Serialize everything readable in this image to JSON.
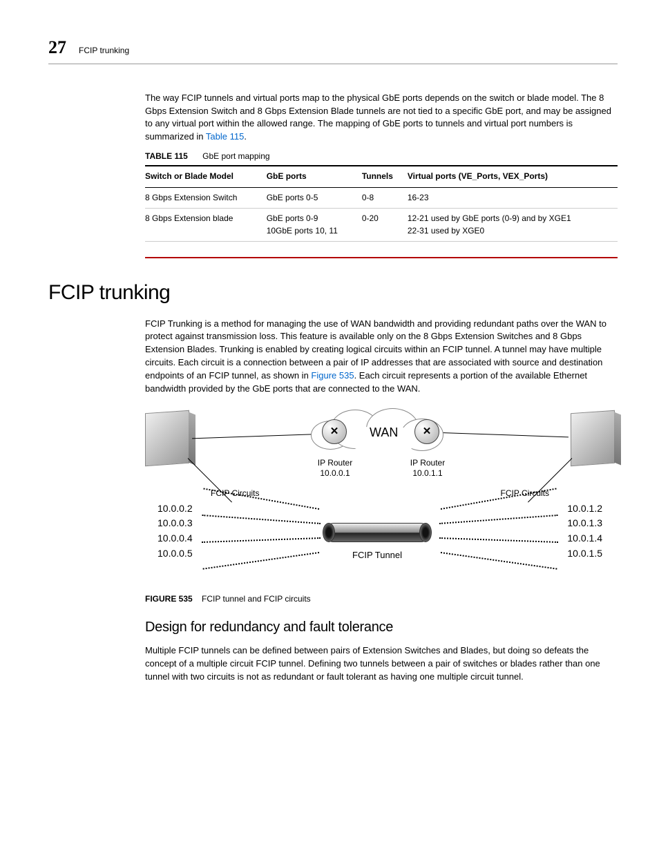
{
  "page_header": {
    "number": "27",
    "section": "FCIP trunking"
  },
  "intro_paragraph": "The way FCIP tunnels and virtual ports map to the physical GbE ports depends on the switch or blade model. The 8 Gbps Extension Switch and 8 Gbps Extension Blade tunnels are not tied to a specific GbE port, and may be assigned to any virtual port within the allowed range. The mapping of GbE ports to tunnels and virtual port numbers is summarized in ",
  "intro_link": "Table 115",
  "intro_tail": ".",
  "table": {
    "label": "TABLE 115",
    "title": "GbE port mapping",
    "headers": [
      "Switch or Blade Model",
      "GbE ports",
      "Tunnels",
      "Virtual ports (VE_Ports, VEX_Ports)"
    ],
    "rows": [
      {
        "model": "8 Gbps Extension Switch",
        "ports": "GbE ports 0-5",
        "tunnels": "0-8",
        "vports": "16-23"
      },
      {
        "model": "8 Gbps Extension blade",
        "ports": "GbE ports 0-9\n10GbE ports 10, 11",
        "tunnels": "0-20",
        "vports": "12-21 used by GbE ports (0-9) and by XGE1\n22-31 used by XGE0"
      }
    ]
  },
  "heading": "FCIP trunking",
  "body1a": "FCIP Trunking is a method for managing the use of WAN bandwidth and providing redundant paths over the WAN to protect against transmission loss. This feature is available only on the 8 Gbps Extension Switches and 8 Gbps Extension Blades. Trunking is enabled by creating logical circuits within an FCIP tunnel. A tunnel may have multiple circuits. Each circuit is a connection between a pair of IP addresses that are associated with source and destination endpoints of an FCIP tunnel, as shown in ",
  "body1_link": "Figure 535",
  "body1b": ". Each circuit represents a portion of the available Ethernet bandwidth provided by the GbE ports that are connected to the WAN.",
  "diagram": {
    "wan": "WAN",
    "router_glyph": "✕",
    "router_left_label": "IP Router\n10.0.0.1",
    "router_right_label": "IP Router\n10.0.1.1",
    "circuits_label": "FCIP Circuits",
    "tunnel_label": "FCIP Tunnel",
    "ips_left": [
      "10.0.0.2",
      "10.0.0.3",
      "10.0.0.4",
      "10.0.0.5"
    ],
    "ips_right": [
      "10.0.1.2",
      "10.0.1.3",
      "10.0.1.4",
      "10.0.1.5"
    ]
  },
  "figure": {
    "label": "FIGURE 535",
    "title": "FCIP tunnel and FCIP circuits"
  },
  "subheading": "Design for redundancy and fault tolerance",
  "body2": "Multiple FCIP tunnels can be defined between pairs of Extension Switches and Blades, but doing so defeats the concept of a multiple circuit FCIP tunnel. Defining two tunnels between a pair of switches or blades rather than one tunnel with two circuits is not as redundant or fault tolerant as having one multiple circuit tunnel."
}
